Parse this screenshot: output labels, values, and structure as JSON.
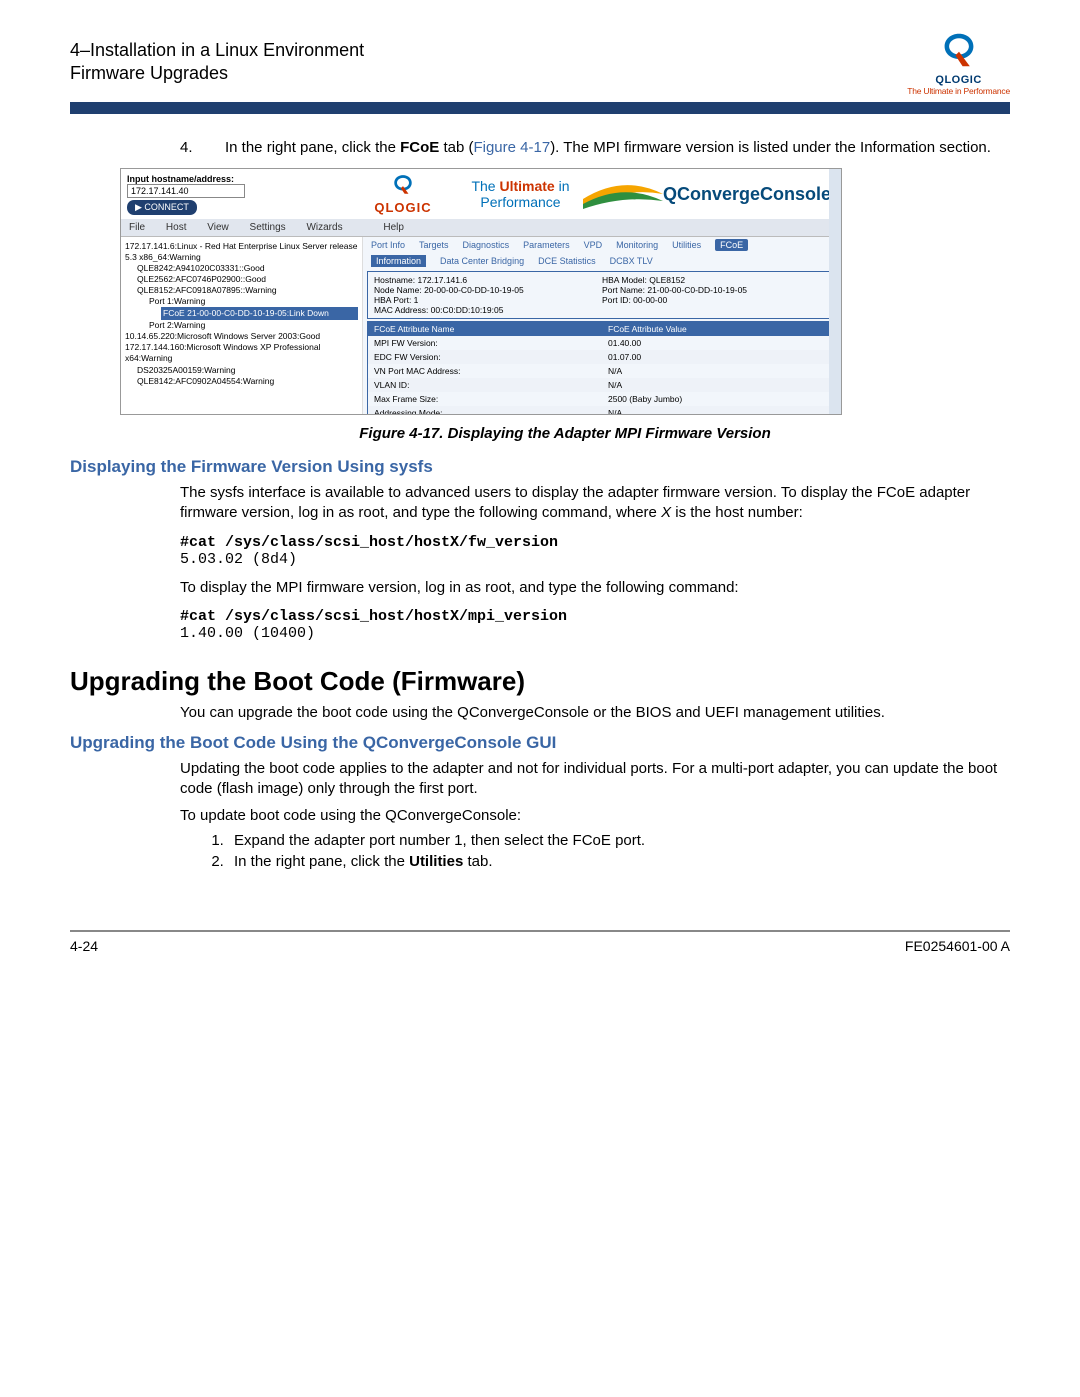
{
  "header": {
    "line1": "4–Installation in a Linux Environment",
    "line2": "Firmware Upgrades"
  },
  "logo": {
    "brand": "QLOGIC",
    "tagline": "The Ultimate in Performance"
  },
  "step4": {
    "num": "4.",
    "text_pre": "In the right pane, click the ",
    "text_bold": "FCoE",
    "text_mid": " tab (",
    "fig_ref": "Figure 4-17",
    "text_post": "). The MPI firmware version is listed under the Information section."
  },
  "figure": {
    "input_label": "Input hostname/address:",
    "input_value": "172.17.141.40",
    "connect_btn": "▶  CONNECT",
    "logo_brand": "QLOGIC",
    "mid_text": "The Ultimate in Performance",
    "qcc": "QConvergeConsole",
    "menu": [
      "File",
      "Host",
      "View",
      "Settings",
      "Wizards",
      "Help"
    ],
    "tree": [
      {
        "cls": "",
        "txt": "172.17.141.6:Linux - Red Hat Enterprise Linux Server release 5.3 x86_64:Warning"
      },
      {
        "cls": "ind1",
        "txt": "QLE8242:A941020C03331::Good"
      },
      {
        "cls": "ind1",
        "txt": "QLE2562:AFC0746P02900::Good"
      },
      {
        "cls": "ind1",
        "txt": "QLE8152:AFC0918A07895::Warning"
      },
      {
        "cls": "ind2",
        "txt": "Port 1:Warning"
      },
      {
        "cls": "ind3 hl",
        "txt": "FCoE 21-00-00-C0-DD-10-19-05:Link Down"
      },
      {
        "cls": "ind2",
        "txt": "Port 2:Warning"
      },
      {
        "cls": "",
        "txt": "10.14.65.220:Microsoft Windows Server 2003:Good"
      },
      {
        "cls": "",
        "txt": "172.17.144.160:Microsoft Windows XP Professional x64:Warning"
      },
      {
        "cls": "ind1",
        "txt": "DS20325A00159:Warning"
      },
      {
        "cls": "ind1",
        "txt": "QLE8142:AFC0902A04554:Warning"
      }
    ],
    "tabs1": [
      "Port Info",
      "Targets",
      "Diagnostics",
      "Parameters",
      "VPD",
      "Monitoring",
      "Utilities",
      "FCoE"
    ],
    "tabs1_active": "FCoE",
    "tabs2": [
      "Information",
      "Data Center Bridging",
      "DCE Statistics",
      "DCBX TLV"
    ],
    "tabs2_active": "Information",
    "info_left": [
      "Hostname:        172.17.141.6",
      "Node Name:   20-00-00-C0-DD-10-19-05",
      "HBA Port:        1",
      "MAC Address: 00:C0:DD:10:19:05"
    ],
    "info_right": [
      "HBA Model:    QLE8152",
      "Port Name:    21-00-00-C0-DD-10-19-05",
      "Port ID:          00-00-00"
    ],
    "table_head": [
      "FCoE Attribute Name",
      "FCoE Attribute Value"
    ],
    "table_rows": [
      [
        "MPI FW Version:",
        "01.40.00"
      ],
      [
        "EDC FW Version:",
        "01.07.00"
      ],
      [
        "VN Port MAC Address:",
        "N/A"
      ],
      [
        "VLAN ID:",
        "N/A"
      ],
      [
        "Max Frame Size:",
        "2500 (Baby Jumbo)"
      ],
      [
        "Addressing Mode:",
        "N/A"
      ]
    ]
  },
  "fig_caption": "Figure 4-17. Displaying the Adapter MPI Firmware Version",
  "sec1": {
    "heading": "Displaying the Firmware Version Using sysfs",
    "p1_pre": "The sysfs interface is available to advanced users to display the adapter firmware version. To display the FCoE adapter firmware version, log in as root, and type the following command, where ",
    "p1_ital": "X",
    "p1_post": " is the host number:",
    "cmd1": "#cat /sys/class/scsi_host/hostX/fw_version",
    "out1": "5.03.02 (8d4)",
    "p2": "To display the MPI firmware version, log in as root, and type the following command:",
    "cmd2": "#cat /sys/class/scsi_host/hostX/mpi_version",
    "out2": "1.40.00 (10400)"
  },
  "sec2": {
    "heading": "Upgrading the Boot Code (Firmware)",
    "p1": "You can upgrade the boot code using the QConvergeConsole or the BIOS and UEFI management utilities."
  },
  "sec3": {
    "heading": "Upgrading the Boot Code Using the QConvergeConsole GUI",
    "p1": "Updating the boot code applies to the adapter and not for individual ports. For a multi-port adapter, you can update the boot code (flash image) only through the first port.",
    "p2": "To update boot code using the QConvergeConsole:",
    "step1": "Expand the adapter port number 1, then select the FCoE port.",
    "step2_pre": "In the right pane, click the ",
    "step2_bold": "Utilities",
    "step2_post": " tab."
  },
  "footer": {
    "left": "4-24",
    "right": "FE0254601-00 A"
  }
}
